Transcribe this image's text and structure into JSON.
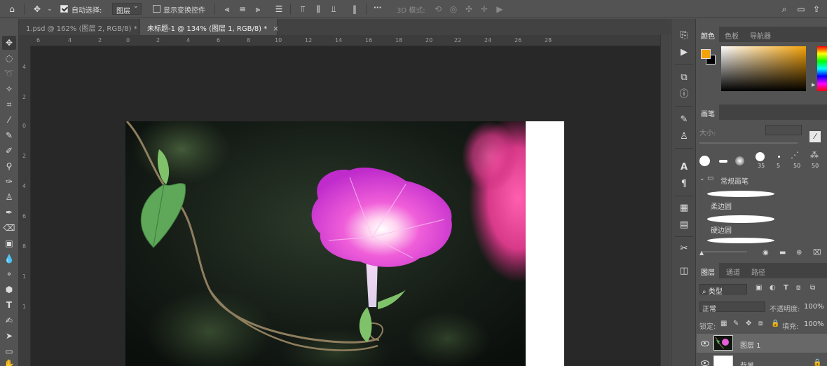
{
  "options_bar": {
    "auto_select_label": "自动选择:",
    "auto_select_checked": true,
    "auto_select_target": "图层",
    "show_transform_label": "显示变换控件",
    "show_transform_checked": false,
    "mode_3d_label": "3D 模式:",
    "more_label": "···"
  },
  "tabs": [
    {
      "label": "1.psd @ 162% (图层 2, RGB/8) *",
      "close": "×",
      "active": false
    },
    {
      "label": "未标题-1 @ 134% (图层 1, RGB/8) *",
      "close": "×",
      "active": true
    }
  ],
  "ruler": {
    "h_ticks": [
      "6",
      "4",
      "2",
      "0",
      "2",
      "4",
      "6",
      "8",
      "10",
      "12",
      "14",
      "16",
      "18",
      "20",
      "22",
      "24",
      "26",
      "28"
    ],
    "v_ticks": [
      "4",
      "2",
      "0",
      "2",
      "4",
      "6",
      "8",
      "1",
      "1"
    ]
  },
  "color_panel": {
    "tabs": [
      "颜色",
      "色板",
      "导航器"
    ],
    "foreground": "#f5a30a",
    "background": "#000000"
  },
  "brush_panel": {
    "title": "画笔",
    "size_label": "大小:",
    "brush_sizes": [
      "35",
      "5",
      "50",
      "50"
    ],
    "group_name": "常规画笔",
    "presets": [
      "柔边圆",
      "硬边圆"
    ]
  },
  "layers_panel": {
    "tabs": [
      "图层",
      "通道",
      "路径"
    ],
    "filter_kind": "类型",
    "blend_mode": "正常",
    "opacity_label": "不透明度:",
    "opacity_value": "100%",
    "lock_label": "锁定:",
    "fill_label": "填充:",
    "fill_value": "100%",
    "layers": [
      {
        "name": "图层 1",
        "selected": true
      },
      {
        "name": "背景",
        "selected": false
      }
    ]
  }
}
